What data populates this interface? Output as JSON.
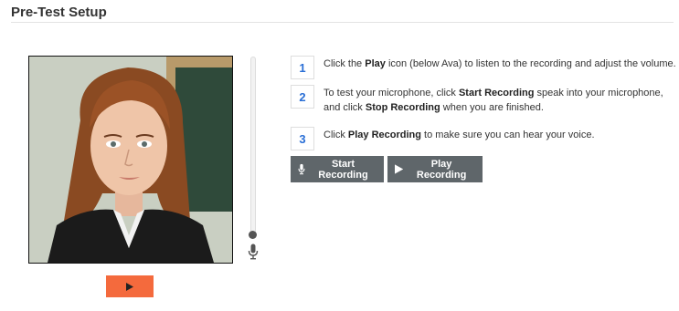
{
  "header": {
    "title": "Pre-Test Setup"
  },
  "steps": [
    {
      "number": "1",
      "pre": "Click the ",
      "bold1": "Play",
      "post1": " icon (below Ava) to listen to the recording and adjust the volume.",
      "bold2": "",
      "post2": ""
    },
    {
      "number": "2",
      "pre": "To test your microphone, click ",
      "bold1": "Start Recording",
      "post1": " speak into your microphone, and click ",
      "bold2": "Stop Recording",
      "post2": " when you are finished."
    },
    {
      "number": "3",
      "pre": "Click ",
      "bold1": "Play Recording",
      "post1": " to make sure you can hear your voice.",
      "bold2": "",
      "post2": ""
    }
  ],
  "buttons": {
    "start_recording": "Start Recording",
    "play_recording": "Play Recording"
  },
  "icons": {
    "avatar": "avatar-ava",
    "play": "play-icon",
    "mic": "microphone-icon"
  },
  "colors": {
    "play_button": "#f46a3d",
    "record_buttons": "#5f666a",
    "step_number": "#2a6fd6"
  }
}
